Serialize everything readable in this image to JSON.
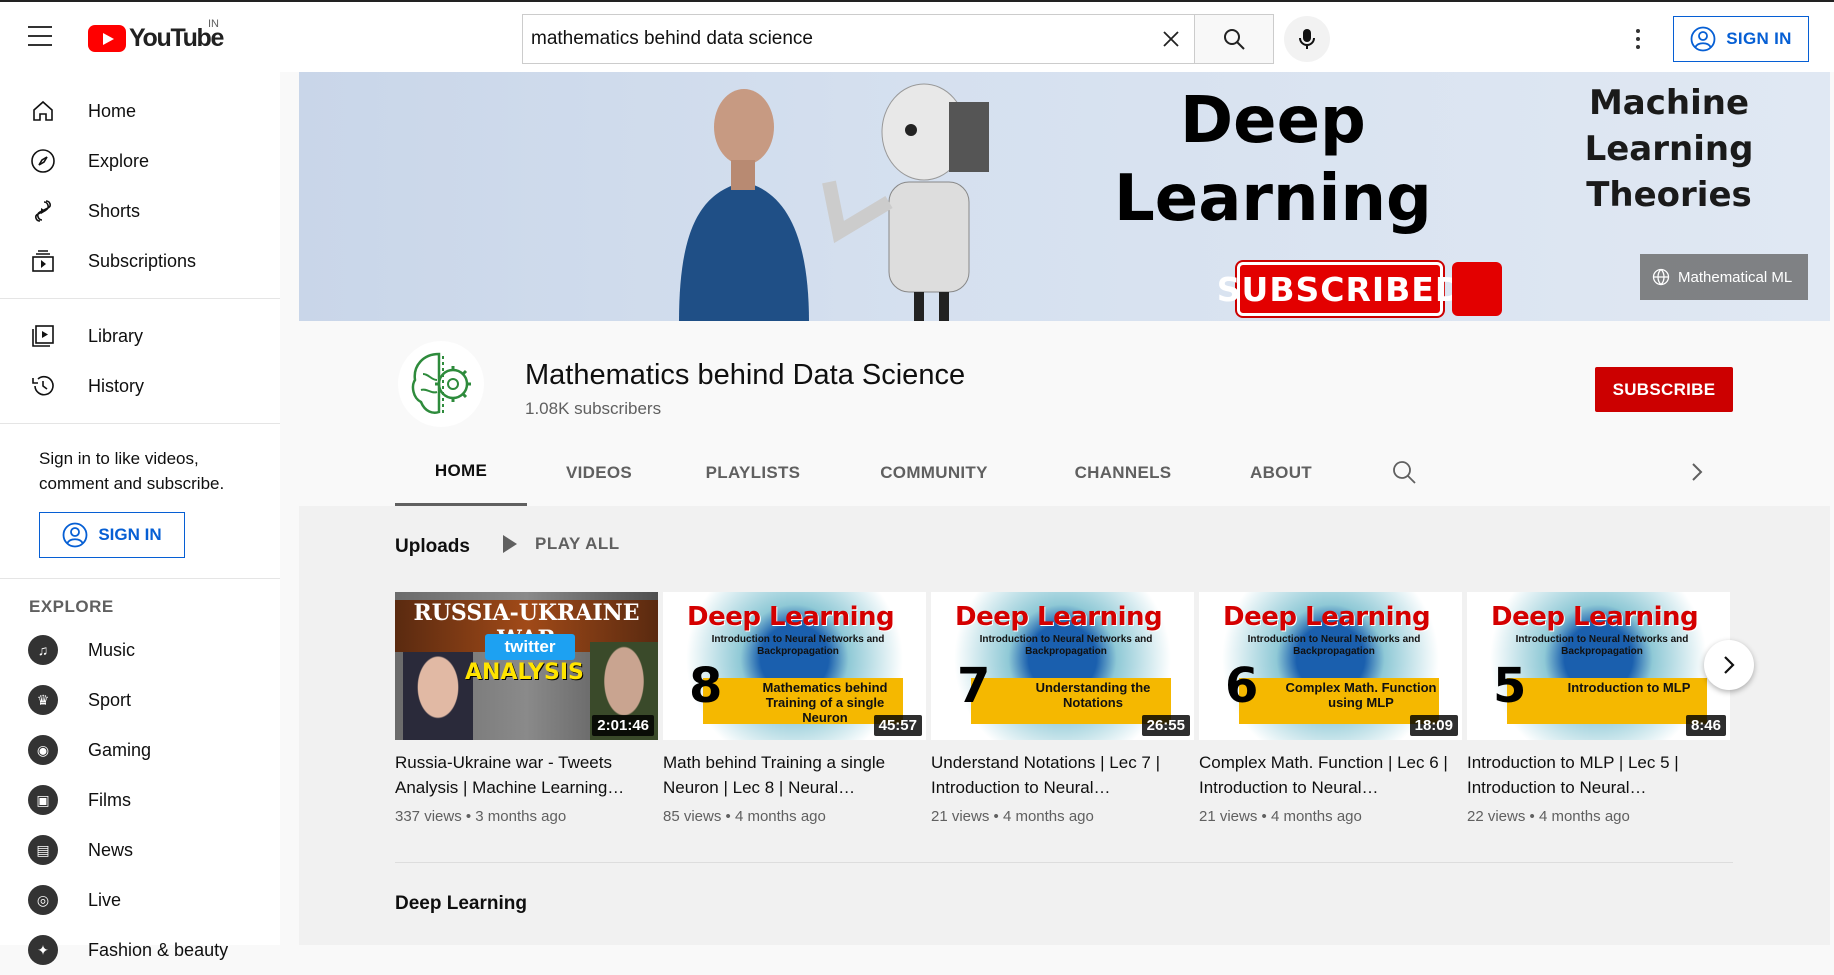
{
  "header": {
    "logo_text": "YouTube",
    "country": "IN",
    "search_value": "mathematics behind data science",
    "signin_label": "SIGN IN"
  },
  "sidebar": {
    "items": [
      {
        "label": "Home",
        "icon": "home-icon"
      },
      {
        "label": "Explore",
        "icon": "compass-icon"
      },
      {
        "label": "Shorts",
        "icon": "shorts-icon"
      },
      {
        "label": "Subscriptions",
        "icon": "subscriptions-icon"
      }
    ],
    "items2": [
      {
        "label": "Library",
        "icon": "library-icon"
      },
      {
        "label": "History",
        "icon": "history-icon"
      }
    ],
    "signin_prompt": "Sign in to like videos, comment and subscribe.",
    "signin_label": "SIGN IN",
    "explore_title": "EXPLORE",
    "explore": [
      {
        "label": "Music",
        "icon": "music-icon"
      },
      {
        "label": "Sport",
        "icon": "trophy-icon"
      },
      {
        "label": "Gaming",
        "icon": "gamepad-icon"
      },
      {
        "label": "Films",
        "icon": "film-icon"
      },
      {
        "label": "News",
        "icon": "news-icon"
      },
      {
        "label": "Live",
        "icon": "live-icon"
      },
      {
        "label": "Fashion & beauty",
        "icon": "fashion-icon"
      }
    ]
  },
  "banner": {
    "headline1": "Deep",
    "headline2": "Learning",
    "subscribed": "SUBSCRIBED",
    "side_title1": "Machine Learning",
    "side_title2": "Theories",
    "link_label": "Mathematical ML"
  },
  "channel": {
    "name": "Mathematics behind Data Science",
    "subscribers": "1.08K subscribers",
    "subscribe_label": "SUBSCRIBE",
    "tabs": [
      "HOME",
      "VIDEOS",
      "PLAYLISTS",
      "COMMUNITY",
      "CHANNELS",
      "ABOUT"
    ],
    "active_tab": "HOME"
  },
  "uploads": {
    "title": "Uploads",
    "play_all": "PLAY ALL",
    "videos": [
      {
        "title": "Russia-Ukraine war - Tweets Analysis | Machine Learning…",
        "views": "337 views",
        "age": "3 months ago",
        "duration": "2:01:46",
        "thumb": {
          "t1": "RUSSIA-UKRAINE WAR",
          "t2": "twitter",
          "t3": "ANALYSIS"
        }
      },
      {
        "title": "Math behind Training a single Neuron | Lec 8 | Neural…",
        "views": "85 views",
        "age": "4 months ago",
        "duration": "45:57",
        "thumb": {
          "head": "Deep Learning",
          "sub": "Introduction to Neural Networks and Backpropagation",
          "num": "8",
          "box": "Mathematics behind Training of a single Neuron"
        }
      },
      {
        "title": "Understand Notations | Lec 7 | Introduction to Neural…",
        "views": "21 views",
        "age": "4 months ago",
        "duration": "26:55",
        "thumb": {
          "head": "Deep Learning",
          "sub": "Introduction to Neural Networks and Backpropagation",
          "num": "7",
          "box": "Understanding the Notations"
        }
      },
      {
        "title": "Complex Math. Function | Lec 6 | Introduction to Neural…",
        "views": "21 views",
        "age": "4 months ago",
        "duration": "18:09",
        "thumb": {
          "head": "Deep Learning",
          "sub": "Introduction to Neural Networks and Backpropagation",
          "num": "6",
          "box": "Complex Math. Function using MLP"
        }
      },
      {
        "title": "Introduction to MLP | Lec 5 | Introduction to Neural…",
        "views": "22 views",
        "age": "4 months ago",
        "duration": "8:46",
        "thumb": {
          "head": "Deep Learning",
          "sub": "Introduction to Neural Networks and Backpropagation",
          "num": "5",
          "box": "Introduction to MLP"
        }
      }
    ]
  },
  "shelf2_title": "Deep Learning"
}
